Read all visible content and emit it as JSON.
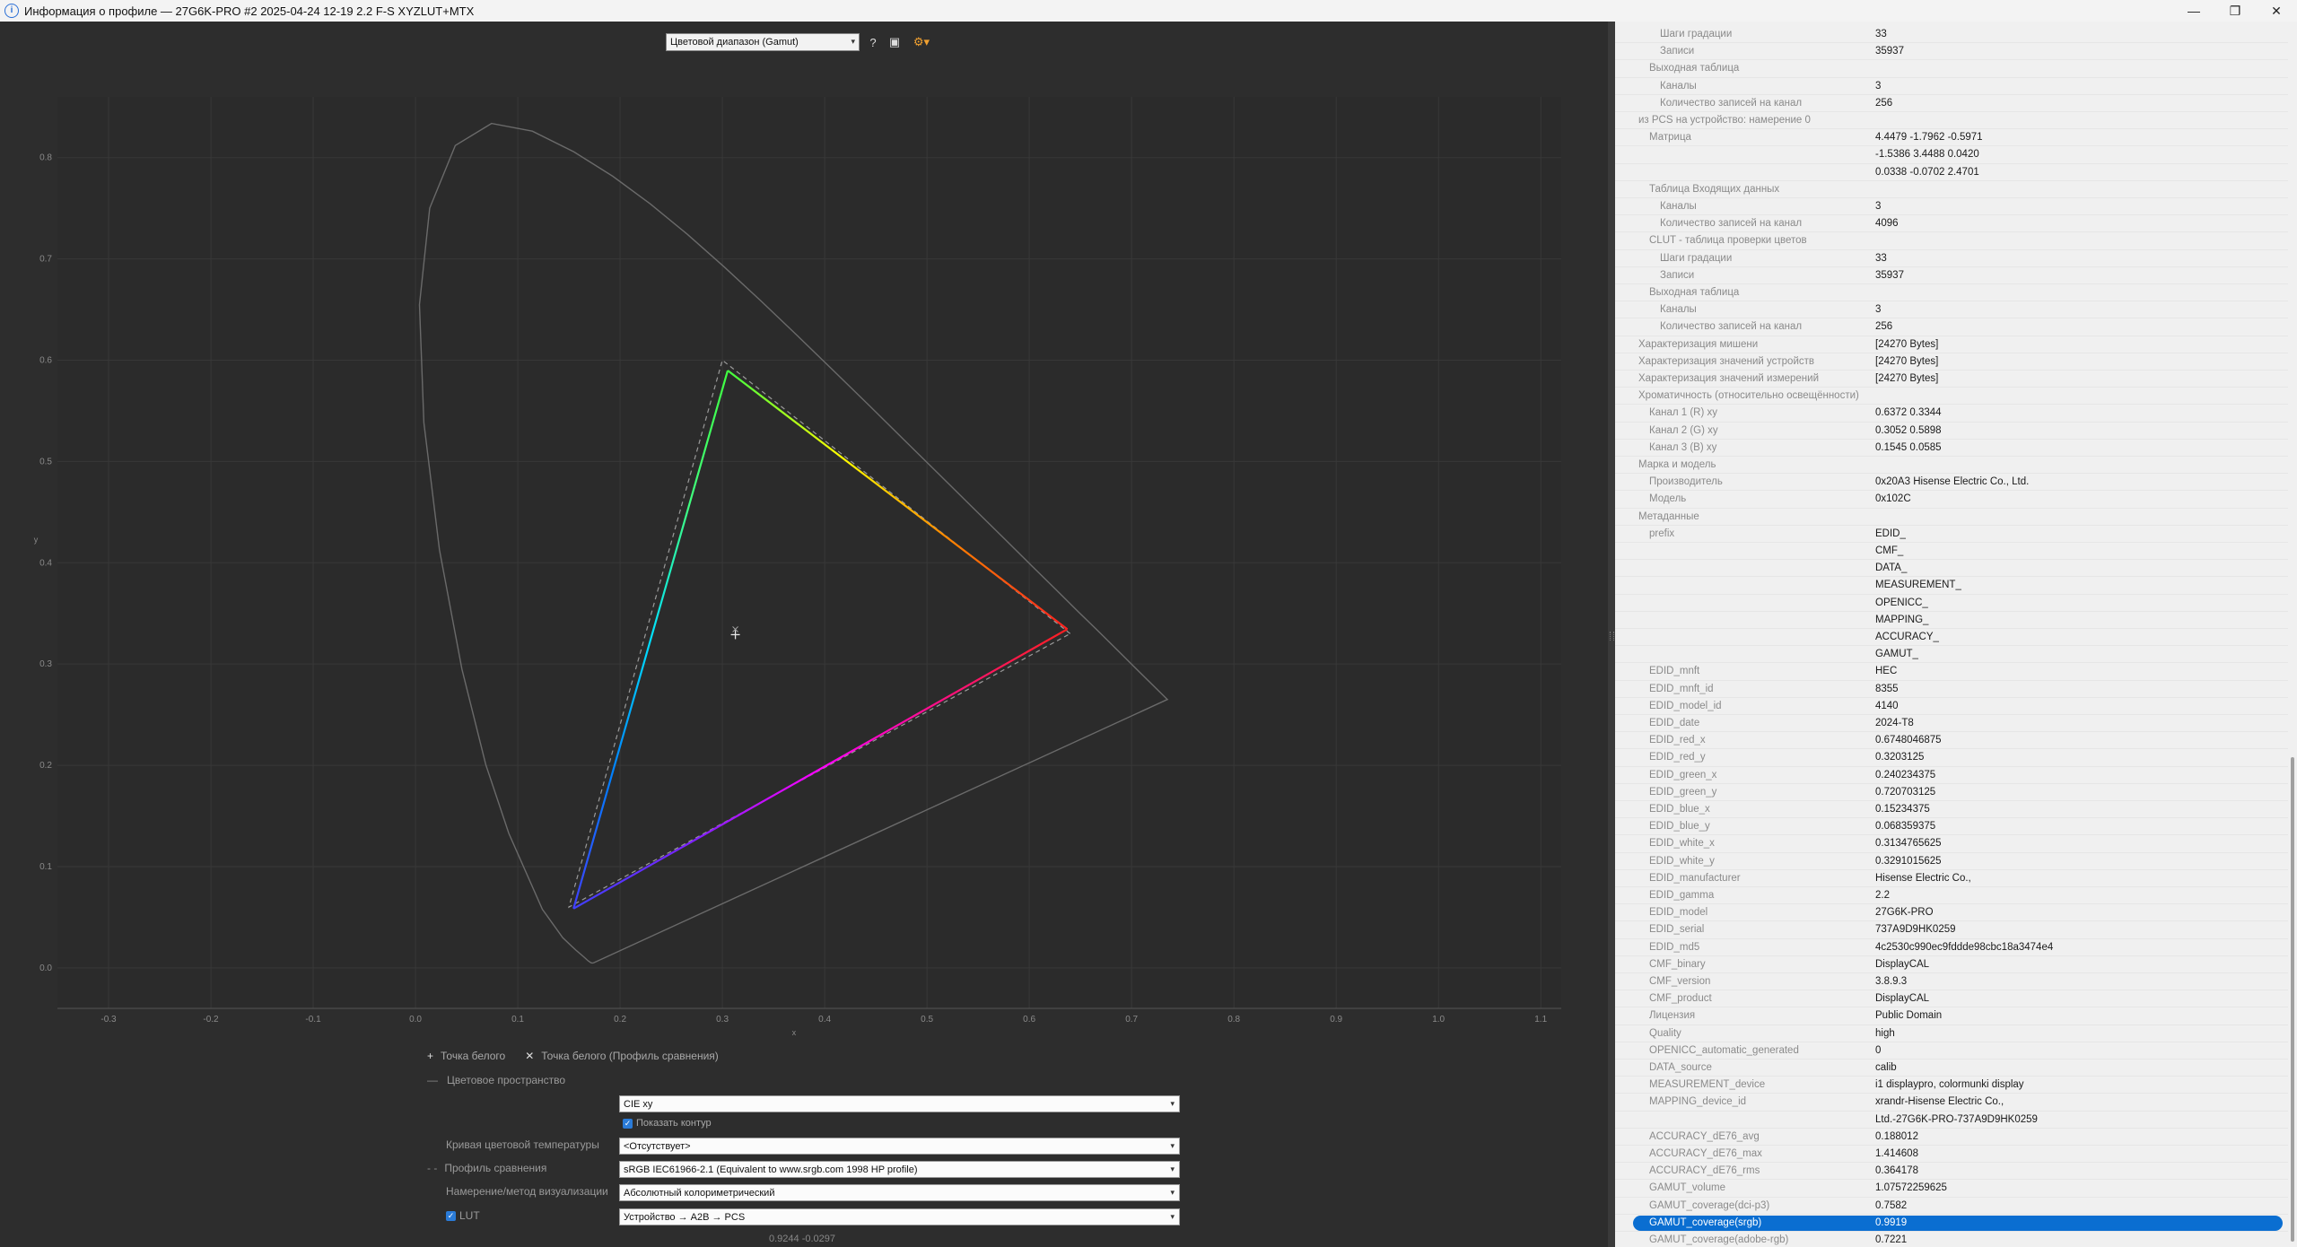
{
  "window": {
    "title": "Информация о профиле — 27G6K-PRO #2 2025-04-24 12-19 2.2 F-S XYZLUT+MTX",
    "controls": [
      "—",
      "❐",
      "✕"
    ]
  },
  "toolbar": {
    "view_select": "Цветовой диапазон (Gamut)",
    "help_icon": "?",
    "save_icon": "▣",
    "options_icon": "⚙▾"
  },
  "chart_data": {
    "type": "scatter",
    "title": "",
    "xlabel": "x",
    "ylabel": "y",
    "xlim": [
      -0.35,
      1.12
    ],
    "ylim": [
      -0.04,
      0.86
    ],
    "x_ticks": [
      "-0.3",
      "-0.2",
      "-0.1",
      "0.0",
      "0.1",
      "0.2",
      "0.3",
      "0.4",
      "0.5",
      "0.6",
      "0.7",
      "0.8",
      "0.9",
      "1.0",
      "1.1"
    ],
    "y_ticks": [
      "0.0",
      "0.1",
      "0.2",
      "0.3",
      "0.4",
      "0.5",
      "0.6",
      "0.7",
      "0.8"
    ],
    "grid": true,
    "gamut_triangle": {
      "red": [
        0.6372,
        0.3344
      ],
      "green": [
        0.3052,
        0.5898
      ],
      "blue": [
        0.1545,
        0.0585
      ]
    },
    "reference_triangle": {
      "red": [
        0.64,
        0.33
      ],
      "green": [
        0.3,
        0.6
      ],
      "blue": [
        0.15,
        0.06
      ]
    },
    "white_point": [
      0.3127,
      0.329
    ],
    "comparison_white_point": [
      0.3127,
      0.329
    ],
    "outer_triangle": {
      "a": [
        0.735,
        0.265
      ],
      "b": [
        0.1741,
        0.005
      ]
    }
  },
  "legend": {
    "white_point": "Точка белого",
    "white_point_comparison": "Точка белого (Профиль сравнения)"
  },
  "controls": {
    "colorspace_label": "Цветовое пространство",
    "colorspace_value": "CIE xy",
    "show_outline_label": "Показать контур",
    "cct_label": "Кривая цветовой температуры",
    "cct_value": "<Отсутствует>",
    "compare_label": "Профиль сравнения",
    "compare_value": "sRGB IEC61966-2.1 (Equivalent to www.srgb.com 1998 HP profile)",
    "intent_label": "Намерение/метод визуализации",
    "intent_value": "Абсолютный колориметрический",
    "lut_label": "LUT",
    "lut_value": "Устройство → A2B → PCS",
    "coords": "0.9244 -0.0297"
  },
  "details": [
    {
      "k": "Шаги градации",
      "v": "33",
      "i": 3
    },
    {
      "k": "Записи",
      "v": "35937",
      "i": 3
    },
    {
      "k": "Выходная таблица",
      "v": "",
      "i": 2
    },
    {
      "k": "Каналы",
      "v": "3",
      "i": 3
    },
    {
      "k": "Количество записей на канал",
      "v": "256",
      "i": 3
    },
    {
      "k": "из PCS на устройство: намерение 0",
      "v": "",
      "i": 1
    },
    {
      "k": "Матрица",
      "v": "4.4479 -1.7962 -0.5971",
      "i": 2
    },
    {
      "k": "",
      "v": "-1.5386 3.4488 0.0420",
      "i": 2
    },
    {
      "k": "",
      "v": "0.0338 -0.0702 2.4701",
      "i": 2
    },
    {
      "k": "Таблица Входящих данных",
      "v": "",
      "i": 2
    },
    {
      "k": "Каналы",
      "v": "3",
      "i": 3
    },
    {
      "k": "Количество записей на канал",
      "v": "4096",
      "i": 3
    },
    {
      "k": "CLUT - таблица проверки цветов",
      "v": "",
      "i": 2
    },
    {
      "k": "Шаги градации",
      "v": "33",
      "i": 3
    },
    {
      "k": "Записи",
      "v": "35937",
      "i": 3
    },
    {
      "k": "Выходная таблица",
      "v": "",
      "i": 2
    },
    {
      "k": "Каналы",
      "v": "3",
      "i": 3
    },
    {
      "k": "Количество записей на канал",
      "v": "256",
      "i": 3
    },
    {
      "k": "Характеризация мишени",
      "v": "[24270 Bytes]",
      "i": 1
    },
    {
      "k": "Характеризация значений устройств",
      "v": "[24270 Bytes]",
      "i": 1
    },
    {
      "k": "Характеризация значений измерений",
      "v": "[24270 Bytes]",
      "i": 1
    },
    {
      "k": "Хроматичность (относительно освещённости)",
      "v": "",
      "i": 1
    },
    {
      "k": "Канал 1 (R) xy",
      "v": "0.6372 0.3344",
      "i": 2
    },
    {
      "k": "Канал 2 (G) xy",
      "v": "0.3052 0.5898",
      "i": 2
    },
    {
      "k": "Канал 3 (B) xy",
      "v": "0.1545 0.0585",
      "i": 2
    },
    {
      "k": "Марка и модель",
      "v": "",
      "i": 1
    },
    {
      "k": "Производитель",
      "v": "0x20A3 Hisense Electric Co., Ltd.",
      "i": 2
    },
    {
      "k": "Модель",
      "v": "0x102C",
      "i": 2
    },
    {
      "k": "Метаданные",
      "v": "",
      "i": 1
    },
    {
      "k": "prefix",
      "v": "EDID_",
      "i": 2
    },
    {
      "k": "",
      "v": "CMF_",
      "i": 2
    },
    {
      "k": "",
      "v": "DATA_",
      "i": 2
    },
    {
      "k": "",
      "v": "MEASUREMENT_",
      "i": 2
    },
    {
      "k": "",
      "v": "OPENICC_",
      "i": 2
    },
    {
      "k": "",
      "v": "MAPPING_",
      "i": 2
    },
    {
      "k": "",
      "v": "ACCURACY_",
      "i": 2
    },
    {
      "k": "",
      "v": "GAMUT_",
      "i": 2
    },
    {
      "k": "EDID_mnft",
      "v": "HEC",
      "i": 2
    },
    {
      "k": "EDID_mnft_id",
      "v": "8355",
      "i": 2
    },
    {
      "k": "EDID_model_id",
      "v": "4140",
      "i": 2
    },
    {
      "k": "EDID_date",
      "v": "2024-T8",
      "i": 2
    },
    {
      "k": "EDID_red_x",
      "v": "0.6748046875",
      "i": 2
    },
    {
      "k": "EDID_red_y",
      "v": "0.3203125",
      "i": 2
    },
    {
      "k": "EDID_green_x",
      "v": "0.240234375",
      "i": 2
    },
    {
      "k": "EDID_green_y",
      "v": "0.720703125",
      "i": 2
    },
    {
      "k": "EDID_blue_x",
      "v": "0.15234375",
      "i": 2
    },
    {
      "k": "EDID_blue_y",
      "v": "0.068359375",
      "i": 2
    },
    {
      "k": "EDID_white_x",
      "v": "0.3134765625",
      "i": 2
    },
    {
      "k": "EDID_white_y",
      "v": "0.3291015625",
      "i": 2
    },
    {
      "k": "EDID_manufacturer",
      "v": "Hisense Electric Co.,",
      "i": 2
    },
    {
      "k": "EDID_gamma",
      "v": "2.2",
      "i": 2
    },
    {
      "k": "EDID_model",
      "v": "27G6K-PRO",
      "i": 2
    },
    {
      "k": "EDID_serial",
      "v": "737A9D9HK0259",
      "i": 2
    },
    {
      "k": "EDID_md5",
      "v": "4c2530c990ec9fddde98cbc18a3474e4",
      "i": 2
    },
    {
      "k": "CMF_binary",
      "v": "DisplayCAL",
      "i": 2
    },
    {
      "k": "CMF_version",
      "v": "3.8.9.3",
      "i": 2
    },
    {
      "k": "CMF_product",
      "v": "DisplayCAL",
      "i": 2
    },
    {
      "k": "Лицензия",
      "v": "Public Domain",
      "i": 2
    },
    {
      "k": "Quality",
      "v": "high",
      "i": 2
    },
    {
      "k": "OPENICC_automatic_generated",
      "v": "0",
      "i": 2
    },
    {
      "k": "DATA_source",
      "v": "calib",
      "i": 2
    },
    {
      "k": "MEASUREMENT_device",
      "v": "i1 displaypro, colormunki display",
      "i": 2
    },
    {
      "k": "MAPPING_device_id",
      "v": "xrandr-Hisense Electric Co.,",
      "i": 2
    },
    {
      "k": "",
      "v": "Ltd.-27G6K-PRO-737A9D9HK0259",
      "i": 2
    },
    {
      "k": "ACCURACY_dE76_avg",
      "v": "0.188012",
      "i": 2
    },
    {
      "k": "ACCURACY_dE76_max",
      "v": "1.414608",
      "i": 2
    },
    {
      "k": "ACCURACY_dE76_rms",
      "v": "0.364178",
      "i": 2
    },
    {
      "k": "GAMUT_volume",
      "v": "1.07572259625",
      "i": 2
    },
    {
      "k": "GAMUT_coverage(dci-p3)",
      "v": "0.7582",
      "i": 2
    },
    {
      "k": "GAMUT_coverage(srgb)",
      "v": "0.9919",
      "i": 2,
      "selected": true
    },
    {
      "k": "GAMUT_coverage(adobe-rgb)",
      "v": "0.7221",
      "i": 2
    }
  ]
}
